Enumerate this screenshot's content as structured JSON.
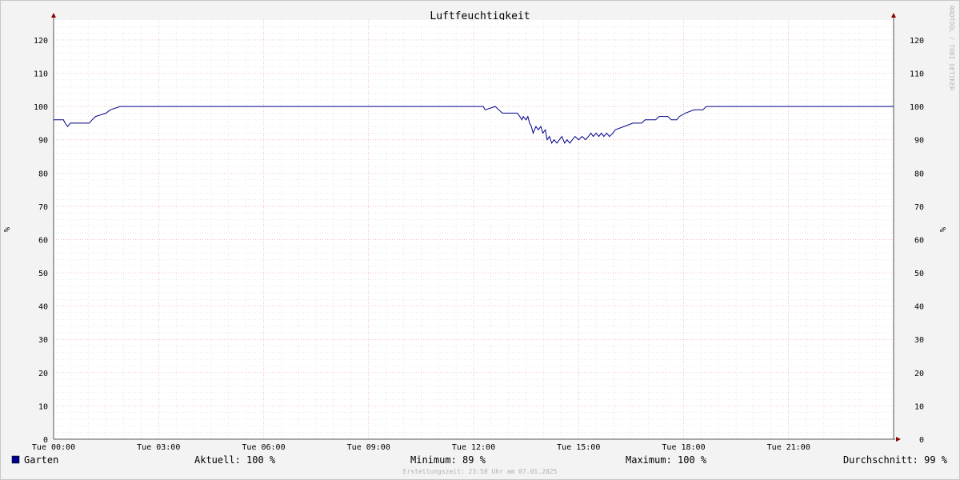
{
  "chart_data": {
    "type": "line",
    "title": "Luftfeuchtigkeit",
    "ylabel": "%",
    "ylim": [
      0,
      126
    ],
    "yticks": [
      0,
      10,
      20,
      30,
      40,
      50,
      60,
      70,
      80,
      90,
      100,
      110,
      120
    ],
    "xlim": [
      0,
      24
    ],
    "xticks": [
      {
        "value": 0,
        "label": "Tue 00:00"
      },
      {
        "value": 3,
        "label": "Tue 03:00"
      },
      {
        "value": 6,
        "label": "Tue 06:00"
      },
      {
        "value": 9,
        "label": "Tue 09:00"
      },
      {
        "value": 12,
        "label": "Tue 12:00"
      },
      {
        "value": 15,
        "label": "Tue 15:00"
      },
      {
        "value": 18,
        "label": "Tue 18:00"
      },
      {
        "value": 21,
        "label": "Tue 21:00"
      }
    ],
    "grid": true,
    "series": [
      {
        "name": "Garten",
        "color": "#00008b",
        "points": [
          [
            0.0,
            96
          ],
          [
            0.28,
            96
          ],
          [
            0.33,
            95
          ],
          [
            0.4,
            94
          ],
          [
            0.48,
            95
          ],
          [
            1.02,
            95
          ],
          [
            1.1,
            96
          ],
          [
            1.2,
            97
          ],
          [
            1.5,
            98
          ],
          [
            1.62,
            99
          ],
          [
            1.9,
            100
          ],
          [
            12.28,
            100
          ],
          [
            12.33,
            99
          ],
          [
            12.62,
            100
          ],
          [
            12.72,
            99
          ],
          [
            12.82,
            98
          ],
          [
            13.25,
            98
          ],
          [
            13.32,
            97
          ],
          [
            13.38,
            96
          ],
          [
            13.42,
            97
          ],
          [
            13.5,
            96
          ],
          [
            13.55,
            97
          ],
          [
            13.6,
            95
          ],
          [
            13.65,
            94
          ],
          [
            13.7,
            92
          ],
          [
            13.78,
            94
          ],
          [
            13.85,
            93
          ],
          [
            13.92,
            94
          ],
          [
            13.98,
            92
          ],
          [
            14.05,
            93
          ],
          [
            14.1,
            90
          ],
          [
            14.17,
            91
          ],
          [
            14.23,
            89
          ],
          [
            14.3,
            90
          ],
          [
            14.38,
            89
          ],
          [
            14.45,
            90
          ],
          [
            14.52,
            91
          ],
          [
            14.6,
            89
          ],
          [
            14.67,
            90
          ],
          [
            14.75,
            89
          ],
          [
            14.82,
            90
          ],
          [
            14.9,
            91
          ],
          [
            15.0,
            90
          ],
          [
            15.1,
            91
          ],
          [
            15.2,
            90
          ],
          [
            15.28,
            91
          ],
          [
            15.35,
            92
          ],
          [
            15.42,
            91
          ],
          [
            15.5,
            92
          ],
          [
            15.58,
            91
          ],
          [
            15.65,
            92
          ],
          [
            15.72,
            91
          ],
          [
            15.8,
            92
          ],
          [
            15.88,
            91
          ],
          [
            15.98,
            92
          ],
          [
            16.05,
            93
          ],
          [
            16.3,
            94
          ],
          [
            16.55,
            95
          ],
          [
            16.8,
            95
          ],
          [
            16.9,
            96
          ],
          [
            17.2,
            96
          ],
          [
            17.3,
            97
          ],
          [
            17.55,
            97
          ],
          [
            17.65,
            96
          ],
          [
            17.8,
            96
          ],
          [
            17.88,
            97
          ],
          [
            18.05,
            98
          ],
          [
            18.3,
            99
          ],
          [
            18.55,
            99
          ],
          [
            18.65,
            100
          ],
          [
            24.0,
            100
          ]
        ]
      }
    ]
  },
  "legend": {
    "series_name": "Garten",
    "current": "Aktuell: 100 %",
    "minimum": "Minimum:  89 %",
    "maximum": "Maximum: 100 %",
    "average": "Durchschnitt:  99 %"
  },
  "footer": "Erstellungszeit: 23:58 Uhr am 07.01.2025",
  "watermark": "RRDTOOL / TOBI OETIKER"
}
